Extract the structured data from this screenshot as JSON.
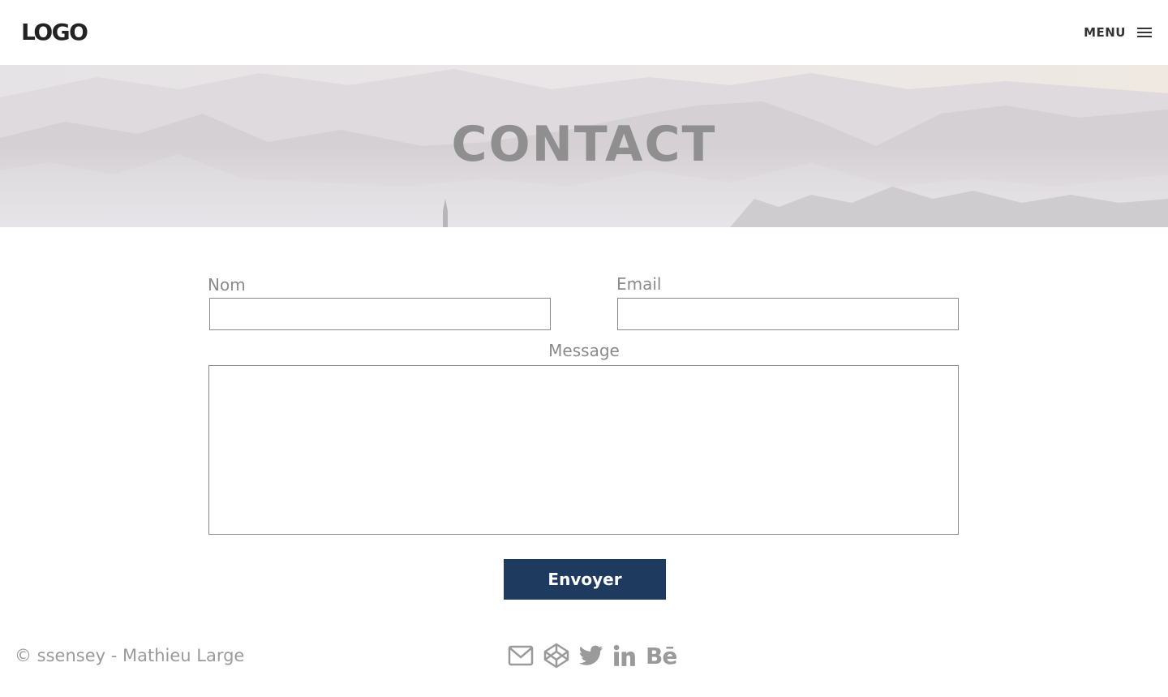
{
  "header": {
    "logo": "LOGO",
    "menu_label": "MENU",
    "menu_icon": "hamburger-icon"
  },
  "hero": {
    "title": "CONTACT"
  },
  "form": {
    "name_label": "Nom",
    "name_value": "",
    "email_label": "Email",
    "email_value": "",
    "message_label": "Message",
    "message_value": "",
    "submit_label": "Envoyer"
  },
  "footer": {
    "copyright": "© ssensey - Mathieu Large",
    "socials": [
      {
        "icon": "envelope-icon"
      },
      {
        "icon": "codepen-icon"
      },
      {
        "icon": "twitter-icon"
      },
      {
        "icon": "linkedin-icon",
        "text": "in"
      },
      {
        "icon": "behance-icon",
        "text": "Bē"
      }
    ]
  },
  "colors": {
    "button_bg": "#1f3a5f",
    "label_gray": "#8a8a8a",
    "hero_title": "#8f8f8f"
  }
}
